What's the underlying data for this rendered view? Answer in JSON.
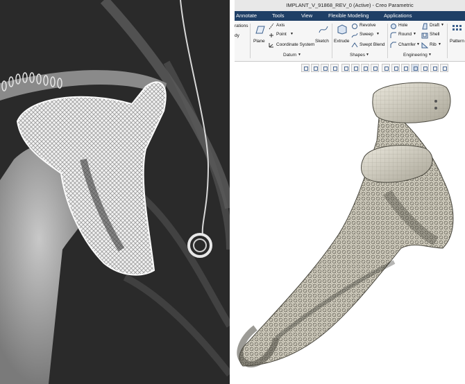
{
  "window": {
    "title": "IMPLANT_V_91868_REV_0 (Active) - Creo Parametric"
  },
  "menu": [
    "Annotate",
    "Tools",
    "View",
    "Flexible Modeling",
    "Applications"
  ],
  "ribbon": {
    "left_partial": [
      "rations",
      "dy"
    ],
    "plane": "Plane",
    "axis": "Axis",
    "point": "Point",
    "coordinate_system": "Coordinate System",
    "sketch": "Sketch",
    "datum_group": "Datum",
    "extrude": "Extrude",
    "revolve": "Revolve",
    "sweep": "Sweep",
    "swept_blend": "Swept Blend",
    "shapes_group": "Shapes",
    "hole": "Hole",
    "round": "Round",
    "chamfer": "Chamfer",
    "draft": "Draft",
    "shell": "Shell",
    "rib": "Rib",
    "engineering_group": "Engineering",
    "pattern": "Pattern"
  },
  "view_toolbar": [
    "zoom-fit-icon",
    "zoom-in-icon",
    "zoom-out-icon",
    "repaint-icon",
    "reorient-icon",
    "saved-views-icon",
    "display-style-icon",
    "view-manager-icon",
    "perspective-icon",
    "section-icon",
    "datum-display-icon",
    "annotation-display-icon",
    "spin-center-icon",
    "pause-icon",
    "more-icon"
  ],
  "colors": {
    "menubar": "#1f3f66",
    "model": "#cdc8b8",
    "xray_bg": "#262626"
  }
}
